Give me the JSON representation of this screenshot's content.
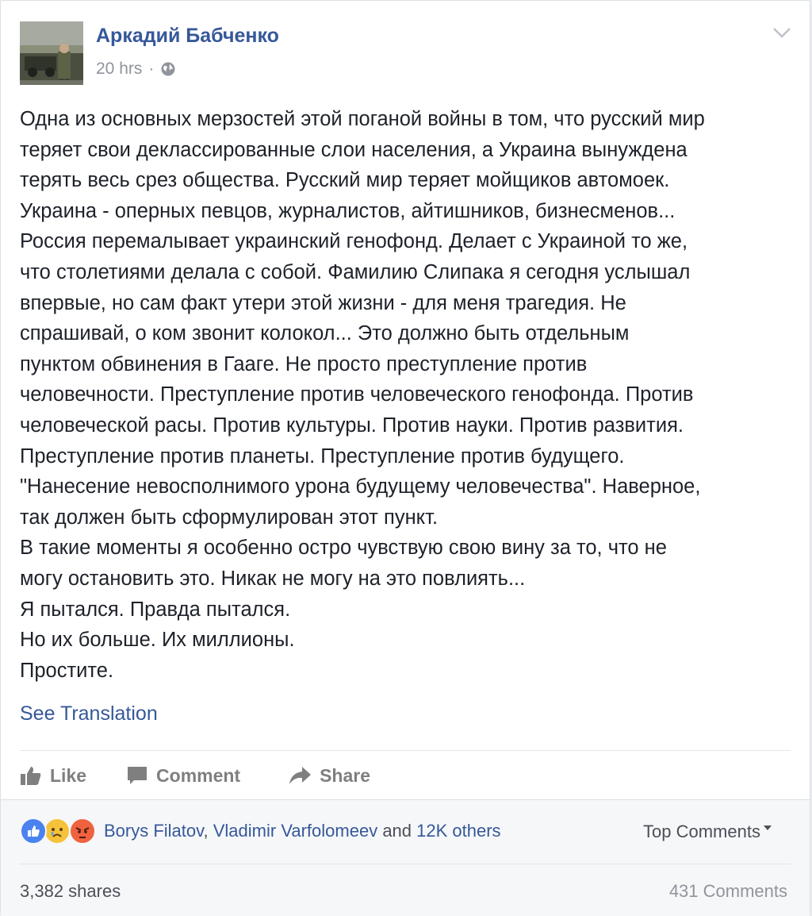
{
  "post": {
    "author": "Аркадий Бабченко",
    "time": "20 hrs",
    "separator": "·",
    "privacy_icon": "globe-icon",
    "menu_icon": "chevron-down-icon",
    "lines": [
      "Одна из основных мерзостей этой поганой войны в том, что русский мир",
      "теряет свои деклассированные слои населения, а Украина вынуждена",
      "терять весь срез общества. Русский мир теряет мойщиков автомоек.",
      "Украина - оперных певцов, журналистов, айтишников, бизнесменов...",
      "Россия перемалывает украинский генофонд. Делает с Украиной то же,",
      "что столетиями делала с собой. Фамилию Слипака я сегодня услышал",
      "впервые, но сам факт утери этой жизни - для меня трагедия. Не",
      "спрашивай, о ком звонит колокол... Это должно быть отдельным",
      "пунктом обвинения в Гааге. Не просто преступление против",
      "человечности. Преступление против человеческого генофонда. Против",
      "человеческой расы. Против культуры. Против науки. Против развития.",
      "Преступление против планеты. Преступление против будущего.",
      "\"Нанесение невосполнимого урона будущему человечества\". Наверное,",
      "так должен быть сформулирован этот пункт.",
      "В такие моменты я особенно остро чувствую свою вину за то, что не",
      "могу остановить это. Никак не могу на это повлиять...",
      "Я пытался. Правда пытался.",
      "Но их больше. Их миллионы.",
      "Простите."
    ],
    "see_translation": "See Translation"
  },
  "actions": {
    "like": "Like",
    "comment": "Comment",
    "share": "Share",
    "like_icon": "thumbs-up-icon",
    "comment_icon": "comment-bubble-icon",
    "share_icon": "share-arrow-icon"
  },
  "reactions": {
    "icons": [
      "like-reaction-icon",
      "sad-reaction-icon",
      "angry-reaction-icon"
    ],
    "name1": "Borys Filatov",
    "comma": ", ",
    "name2": "Vladimir Varfolomeev",
    "and": " and ",
    "others": "12K others",
    "top_comments": "Top Comments"
  },
  "stats": {
    "shares": "3,382 shares",
    "comments": "431 Comments"
  },
  "colors": {
    "link": "#365899",
    "text": "#1d2129",
    "muted": "#90949c",
    "action": "#7f7f7f",
    "like_blue": "#4a82f0",
    "angry_orange": "#f0623f",
    "sad_yellow": "#f5c33b"
  }
}
